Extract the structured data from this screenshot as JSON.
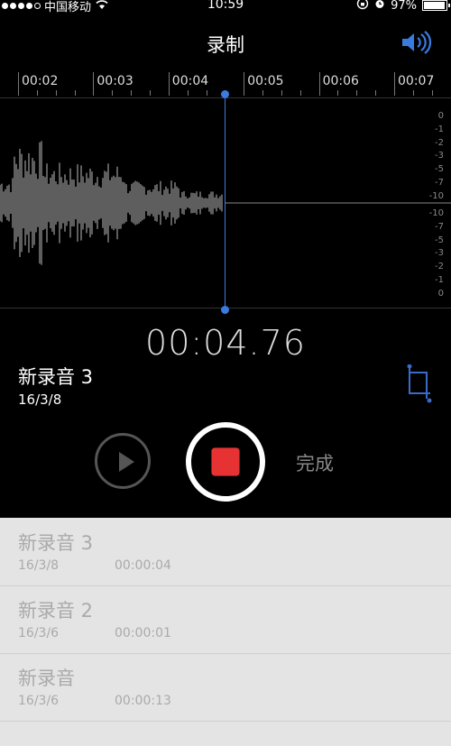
{
  "status_bar": {
    "carrier": "中国移动",
    "time": "10:59",
    "battery": "97%",
    "battery_level": 0.97
  },
  "header": {
    "title": "录制",
    "speaker_icon": "speaker-icon"
  },
  "timeline": {
    "labels": [
      "00:02",
      "00:03",
      "00:04",
      "00:05",
      "00:06",
      "00:07"
    ],
    "db_top": [
      "0",
      "-1",
      "-2",
      "-3",
      "-5",
      "-7",
      "-10"
    ],
    "db_bottom": [
      "-10",
      "-7",
      "-5",
      "-3",
      "-2",
      "-1",
      "0"
    ]
  },
  "recorder": {
    "elapsed": "00:04.76",
    "recording_name": "新录音 3",
    "recording_date": "16/3/8",
    "done_label": "完成",
    "play_icon": "play-icon",
    "stop_icon": "stop-icon",
    "trim_icon": "trim-icon"
  },
  "recordings": [
    {
      "name": "新录音 3",
      "date": "16/3/8",
      "duration": "00:00:04"
    },
    {
      "name": "新录音 2",
      "date": "16/3/6",
      "duration": "00:00:01"
    },
    {
      "name": "新录音",
      "date": "16/3/6",
      "duration": "00:00:13"
    }
  ],
  "colors": {
    "accent": "#3a7be0",
    "record": "#e63232"
  }
}
